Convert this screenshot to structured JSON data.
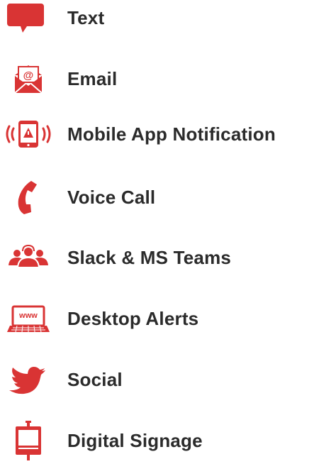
{
  "accent_color": "#d93434",
  "text_color": "#2b2b2b",
  "channels": [
    {
      "label": "Text",
      "icon": "speech-bubble-icon"
    },
    {
      "label": "Email",
      "icon": "email-envelope-icon"
    },
    {
      "label": "Mobile App Notification",
      "icon": "mobile-phone-alert-icon"
    },
    {
      "label": "Voice Call",
      "icon": "phone-handset-icon"
    },
    {
      "label": "Slack & MS Teams",
      "icon": "people-group-icon"
    },
    {
      "label": "Desktop Alerts",
      "icon": "laptop-www-icon"
    },
    {
      "label": "Social",
      "icon": "twitter-bird-icon"
    },
    {
      "label": "Digital Signage",
      "icon": "digital-sign-icon"
    }
  ]
}
